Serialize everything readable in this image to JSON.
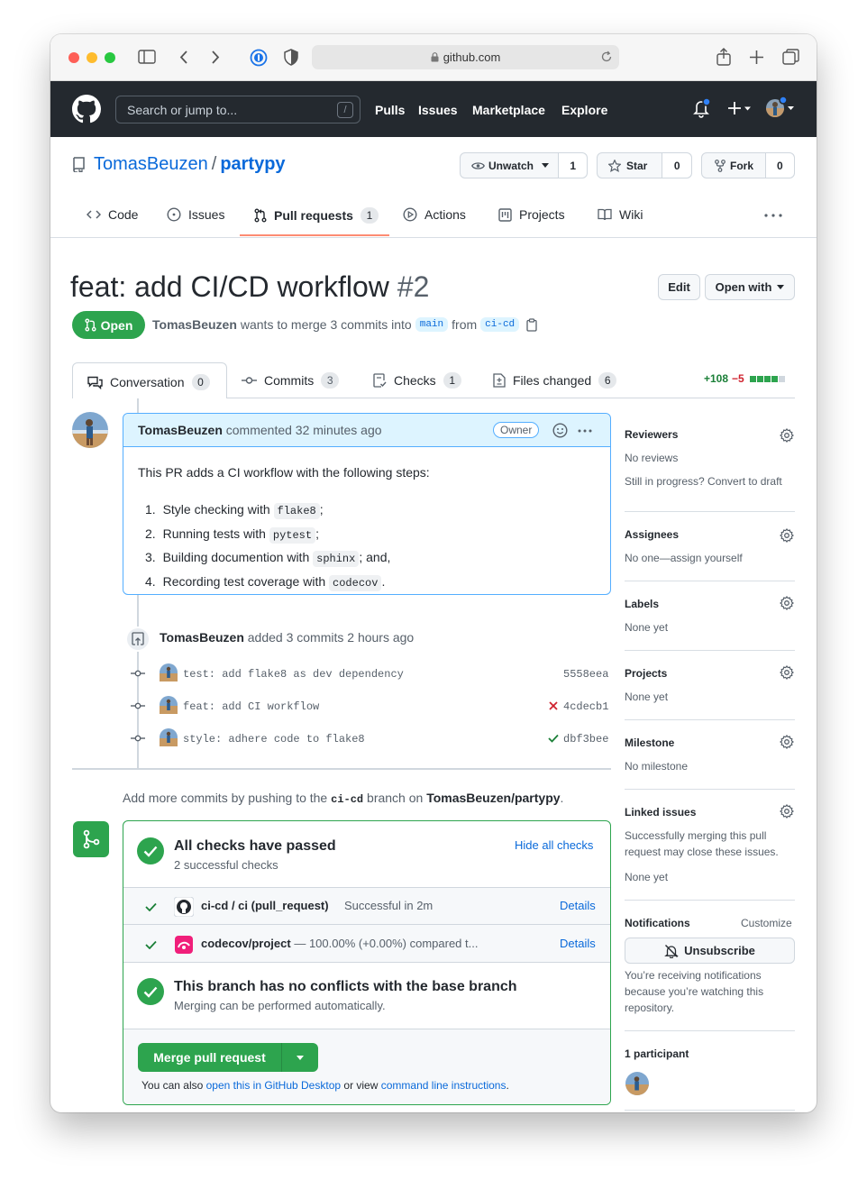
{
  "browser": {
    "url": "github.com"
  },
  "gh_header": {
    "search_placeholder": "Search or jump to...",
    "search_shortcut": "/",
    "nav": [
      "Pulls",
      "Issues",
      "Marketplace",
      "Explore"
    ]
  },
  "repo": {
    "owner": "TomasBeuzen",
    "separator": "/",
    "name": "partypy",
    "watch_label": "Unwatch",
    "watch_count": "1",
    "star_label": "Star",
    "star_count": "0",
    "fork_label": "Fork",
    "fork_count": "0"
  },
  "repo_tabs": [
    {
      "label": "Code"
    },
    {
      "label": "Issues"
    },
    {
      "label": "Pull requests",
      "count": "1"
    },
    {
      "label": "Actions"
    },
    {
      "label": "Projects"
    },
    {
      "label": "Wiki"
    }
  ],
  "pr": {
    "title": "feat: add CI/CD workflow",
    "number": "#2",
    "edit_label": "Edit",
    "open_with_label": "Open with",
    "state": "Open",
    "author": "TomasBeuzen",
    "merge_text": "wants to merge 3 commits into",
    "base_branch": "main",
    "from_text": "from",
    "head_branch": "ci-cd"
  },
  "pr_tabs": [
    {
      "label": "Conversation",
      "count": "0"
    },
    {
      "label": "Commits",
      "count": "3"
    },
    {
      "label": "Checks",
      "count": "1"
    },
    {
      "label": "Files changed",
      "count": "6"
    }
  ],
  "diffstat": {
    "additions": "+108",
    "deletions": "−5"
  },
  "comment": {
    "author": "TomasBeuzen",
    "meta": "commented 32 minutes ago",
    "badge": "Owner",
    "intro": "This PR adds a CI workflow with the following steps:",
    "steps": [
      {
        "num": "1.",
        "text": "Style checking with",
        "code": "flake8",
        "tail": ";"
      },
      {
        "num": "2.",
        "text": "Running tests with",
        "code": "pytest",
        "tail": ";"
      },
      {
        "num": "3.",
        "text": "Building documention with",
        "code": "sphinx",
        "tail": "; and,"
      },
      {
        "num": "4.",
        "text": "Recording test coverage with",
        "code": "codecov",
        "tail": "."
      }
    ]
  },
  "commits_event": {
    "author": "TomasBeuzen",
    "meta": "added 3 commits 2 hours ago",
    "commits": [
      {
        "message": "test: add flake8 as dev dependency",
        "sha": "5558eea",
        "status": "none"
      },
      {
        "message": "feat: add CI workflow",
        "sha": "4cdecb1",
        "status": "fail"
      },
      {
        "message": "style: adhere code to flake8",
        "sha": "dbf3bee",
        "status": "pass"
      }
    ]
  },
  "push_hint": {
    "prefix": "Add more commits by pushing to the",
    "branch": "ci-cd",
    "middle": "branch on",
    "repo": "TomasBeuzen/partypy",
    "suffix": "."
  },
  "checks": {
    "title": "All checks have passed",
    "subtitle": "2 successful checks",
    "hide_label": "Hide all checks",
    "items": [
      {
        "name": "ci-cd / ci (pull_request)",
        "desc": "Successful in 2m",
        "link": "Details"
      },
      {
        "name": "codecov/project",
        "desc": "— 100.00% (+0.00%) compared t...",
        "link": "Details"
      }
    ],
    "conflict_title": "This branch has no conflicts with the base branch",
    "conflict_sub": "Merging can be performed automatically.",
    "merge_label": "Merge pull request",
    "footer_prefix": "You can also",
    "footer_link1": "open this in GitHub Desktop",
    "footer_middle": "or view",
    "footer_link2": "command line instructions",
    "footer_suffix": "."
  },
  "sidebar": {
    "reviewers_h": "Reviewers",
    "reviewers_t": "No reviews",
    "reviewers_t2": "Still in progress? Convert to draft",
    "assignees_h": "Assignees",
    "assignees_t": "No one—assign yourself",
    "labels_h": "Labels",
    "labels_t": "None yet",
    "projects_h": "Projects",
    "projects_t": "None yet",
    "milestone_h": "Milestone",
    "milestone_t": "No milestone",
    "linked_h": "Linked issues",
    "linked_t1": "Successfully merging this pull",
    "linked_t2": "request may close these issues.",
    "linked_t3": "None yet",
    "notifications_h": "Notifications",
    "customize": "Customize",
    "unsubscribe": "Unsubscribe",
    "notif_t1": "You’re receiving notifications",
    "notif_t2": "because you’re watching this",
    "notif_t3": "repository.",
    "participants_h": "1 participant"
  },
  "colors": {
    "green": "#2da44e",
    "blue": "#0969da",
    "red": "#cf222e",
    "dark": "#24292f"
  }
}
